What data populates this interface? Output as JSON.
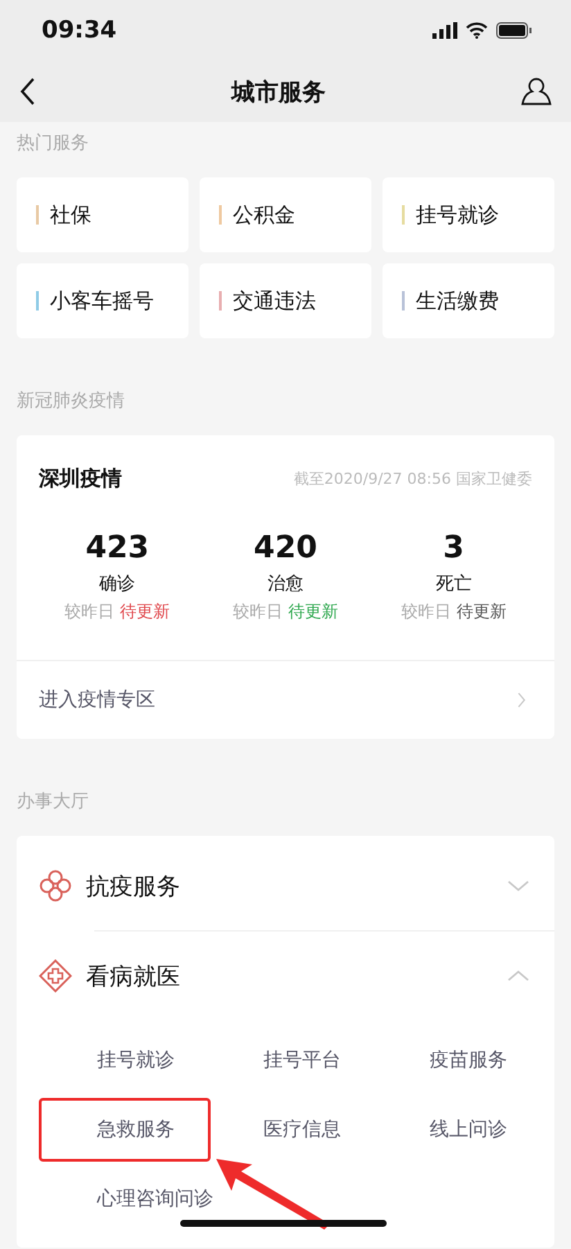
{
  "status_bar": {
    "time": "09:34"
  },
  "nav": {
    "title": "城市服务"
  },
  "hot_services": {
    "label": "热门服务",
    "items": [
      {
        "label": "社保",
        "color": "#e8c9a4"
      },
      {
        "label": "公积金",
        "color": "#efc9a0"
      },
      {
        "label": "挂号就诊",
        "color": "#e6dca0"
      },
      {
        "label": "小客车摇号",
        "color": "#8fcbe6"
      },
      {
        "label": "交通违法",
        "color": "#e8aeb0"
      },
      {
        "label": "生活缴费",
        "color": "#b8c2d8"
      }
    ]
  },
  "epidemic": {
    "label": "新冠肺炎疫情",
    "card": {
      "title": "深圳疫情",
      "source": "截至2020/9/27 08:56 国家卫健委",
      "stats": [
        {
          "value": "423",
          "name": "确诊",
          "compare": "较昨日",
          "change": "待更新",
          "color": "#e0474c"
        },
        {
          "value": "420",
          "name": "治愈",
          "compare": "较昨日",
          "change": "待更新",
          "color": "#2fa84f"
        },
        {
          "value": "3",
          "name": "死亡",
          "compare": "较昨日",
          "change": "待更新",
          "color": "#555555"
        }
      ],
      "link": "进入疫情专区"
    }
  },
  "hall": {
    "label": "办事大厅",
    "sections": [
      {
        "title": "抗疫服务",
        "expanded": false
      },
      {
        "title": "看病就医",
        "expanded": true,
        "items": [
          {
            "label": "挂号就诊",
            "highlighted": false
          },
          {
            "label": "挂号平台",
            "highlighted": false
          },
          {
            "label": "疫苗服务",
            "highlighted": false
          },
          {
            "label": "急救服务",
            "highlighted": true
          },
          {
            "label": "医疗信息",
            "highlighted": false
          },
          {
            "label": "线上问诊",
            "highlighted": false
          },
          {
            "label": "心理咨询问诊",
            "highlighted": false
          }
        ]
      }
    ]
  }
}
